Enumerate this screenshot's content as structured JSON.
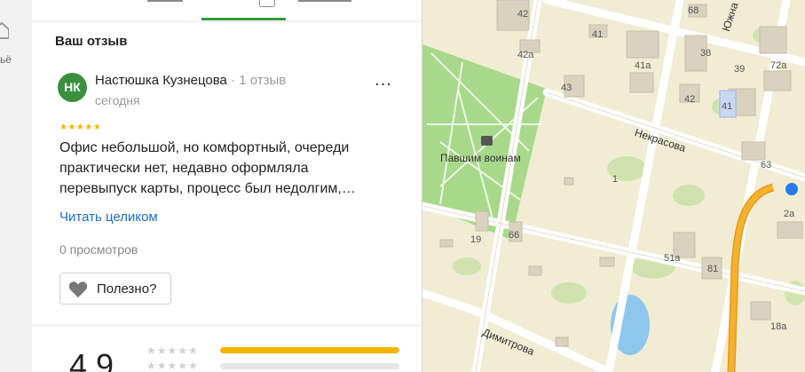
{
  "left_rail": {
    "text": "ьё",
    "icon": "home-icon"
  },
  "review": {
    "section_title": "Ваш отзыв",
    "avatar_initials": "НК",
    "avatar_color": "#3b8f3e",
    "author": "Настюшка Кузнецова",
    "separator": "·",
    "reviews_count": "1 отзыв",
    "date": "сегодня",
    "more_label": "...",
    "stars_text": "★★★★★",
    "rating": 5,
    "text_lines": [
      "Офис небольшой, но комфортный, очереди",
      "практически нет, недавно оформляла",
      "перевыпуск карты, процесс был недолгим,…"
    ],
    "read_more": "Читать целиком",
    "views": "0 просмотров",
    "useful_label": "Полезно?"
  },
  "summary": {
    "rating": "4,9",
    "distribution": [
      {
        "stars_text": "★★★★★",
        "fill": 1.0
      },
      {
        "stars_text": "★★★★★",
        "fill": 0.0
      }
    ]
  },
  "map": {
    "street_labels": [
      "Некрасова",
      "Южна",
      "Димитрова"
    ],
    "poi_label": "Павшим воинам",
    "building_numbers": [
      "42",
      "68",
      "41",
      "38",
      "42а",
      "41а",
      "39",
      "72а",
      "43",
      "42",
      "41",
      "1",
      "63",
      "19",
      "66",
      "2а",
      "51а",
      "81",
      "18а"
    ]
  }
}
